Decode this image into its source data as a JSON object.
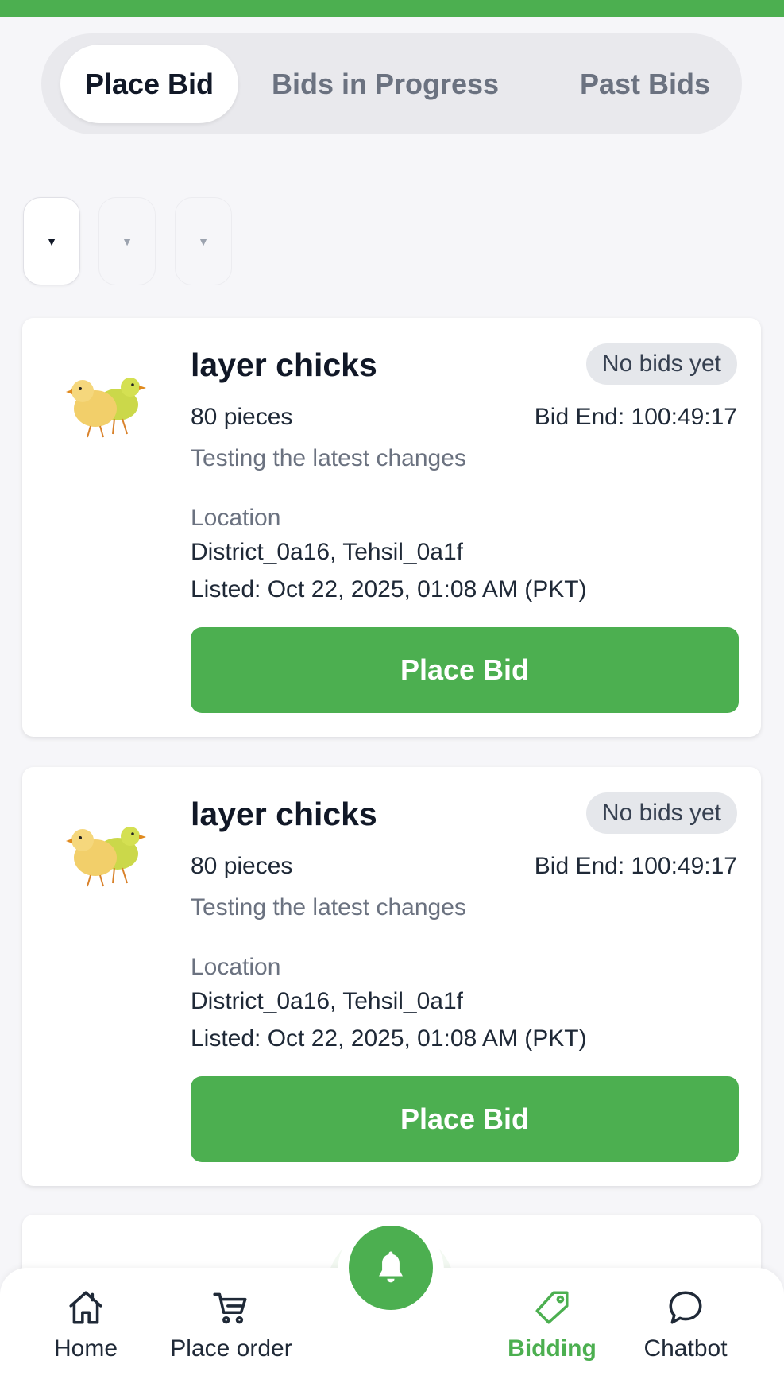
{
  "tabs": [
    {
      "label": "Place Bid",
      "active": true
    },
    {
      "label": "Bids in Progress",
      "active": false
    },
    {
      "label": "Past Bids",
      "active": false
    }
  ],
  "filters": [
    {
      "glyph": "▼",
      "active": true
    },
    {
      "glyph": "▼",
      "active": false
    },
    {
      "glyph": "▼",
      "active": false
    }
  ],
  "cards": [
    {
      "icon": "chicks-image",
      "title": "layer chicks",
      "badge": "No bids yet",
      "quantity": "80 pieces",
      "bid_end": "Bid End: 100:49:17",
      "description": "Testing the latest changes",
      "location_label": "Location",
      "location": "District_0a16, Tehsil_0a1f",
      "listed": "Listed: Oct 22, 2025, 01:08 AM (PKT)",
      "button": "Place Bid"
    },
    {
      "icon": "chicks-image",
      "title": "layer chicks",
      "badge": "No bids yet",
      "quantity": "80 pieces",
      "bid_end": "Bid End: 100:49:17",
      "description": "Testing the latest changes",
      "location_label": "Location",
      "location": "District_0a16, Tehsil_0a1f",
      "listed": "Listed: Oct 22, 2025, 01:08 AM (PKT)",
      "button": "Place Bid"
    }
  ],
  "nav": {
    "items": [
      {
        "label": "Home",
        "icon": "home-icon",
        "active": false
      },
      {
        "label": "Place order",
        "icon": "cart-icon",
        "active": false
      },
      {
        "label": "Bidding",
        "icon": "tag-icon",
        "active": true
      },
      {
        "label": "Chatbot",
        "icon": "chat-bubble-icon",
        "active": false
      }
    ],
    "fab_icon": "bell-icon"
  },
  "colors": {
    "accent": "#4caf50",
    "background": "#f6f6f9",
    "card": "#ffffff",
    "badge_bg": "#e5e7eb",
    "muted_text": "#6b7280"
  }
}
